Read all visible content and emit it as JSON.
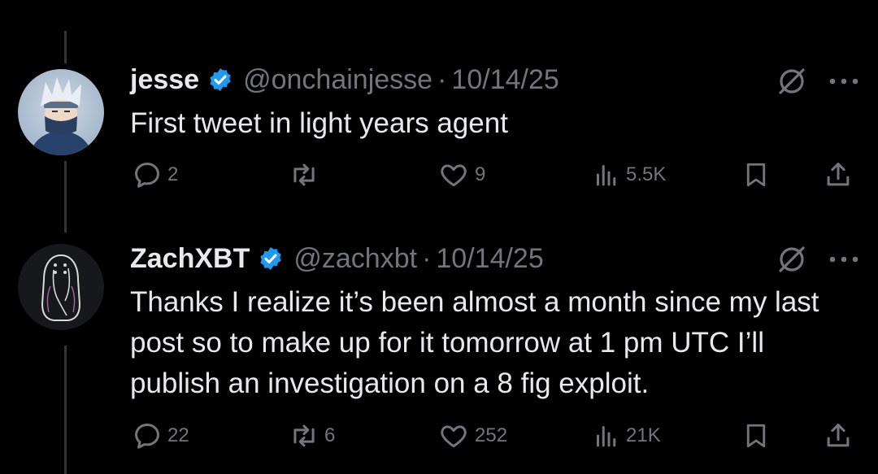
{
  "tweets": [
    {
      "name": "jesse",
      "handle": "@onchainjesse",
      "separator": "·",
      "date": "10/14/25",
      "text": "First tweet in light years agent",
      "replies": "2",
      "reposts": "",
      "likes": "9",
      "views": "5.5K"
    },
    {
      "name": "ZachXBT",
      "handle": "@zachxbt",
      "separator": "·",
      "date": "10/14/25",
      "text": "Thanks I realize it’s been almost a month since my last post so to make up for it tomorrow at 1 pm UTC I’ll publish an investigation on a 8 fig exploit.",
      "replies": "22",
      "reposts": "6",
      "likes": "252",
      "views": "21K"
    }
  ],
  "colors": {
    "background": "#000000",
    "text": "#e7e9ea",
    "muted": "#71767b",
    "verified": "#1d9bf0",
    "thread_line": "#333639"
  },
  "icons": [
    "verified-badge-icon",
    "grok-icon",
    "more-icon",
    "reply-icon",
    "repost-icon",
    "like-icon",
    "views-icon",
    "bookmark-icon",
    "share-icon"
  ]
}
